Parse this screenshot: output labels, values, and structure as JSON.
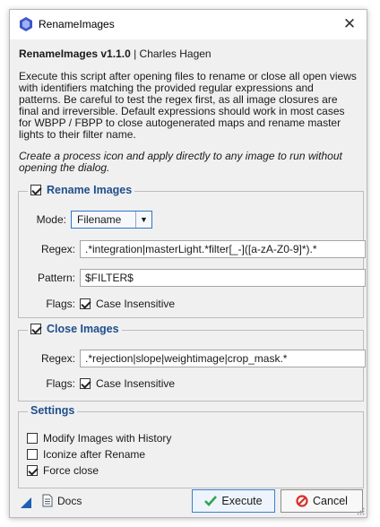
{
  "window": {
    "title": "RenameImages",
    "close_symbol": "✕"
  },
  "header": {
    "name": "RenameImages v1.1.0",
    "separator": " | ",
    "author": "Charles Hagen"
  },
  "description": "Execute this script after opening files to rename or close all open views with identifiers matching the provided regular expressions and patterns. Be careful to test the regex first, as all image closures are final and irreversible. Default expressions should work in most cases for WBPP / FBPP to close autogenerated maps and rename master lights to their filter name.",
  "instruction": "Create a process icon and apply directly to any image to run without opening the dialog.",
  "rename_group": {
    "title": "Rename Images",
    "enabled": true,
    "mode_label": "Mode:",
    "mode_value": "Filename",
    "regex_label": "Regex:",
    "regex_value": ".*integration|masterLight.*filter[_-]([a-zA-Z0-9]*).*",
    "pattern_label": "Pattern:",
    "pattern_value": "$FILTER$",
    "flags_label": "Flags:",
    "case_label": "Case Insensitive",
    "case_checked": true
  },
  "close_group": {
    "title": "Close Images",
    "enabled": true,
    "regex_label": "Regex:",
    "regex_value": ".*rejection|slope|weightimage|crop_mask.*",
    "flags_label": "Flags:",
    "case_label": "Case Insensitive",
    "case_checked": true
  },
  "settings_group": {
    "title": "Settings",
    "options": [
      {
        "label": "Modify Images with History",
        "checked": false
      },
      {
        "label": "Iconize after Rename",
        "checked": false
      },
      {
        "label": "Force close",
        "checked": true
      }
    ]
  },
  "footer": {
    "docs_label": "Docs",
    "execute_label": "Execute",
    "cancel_label": "Cancel"
  },
  "colors": {
    "accent": "#1f4e8c",
    "execute_check": "#2fa44f",
    "cancel_icon": "#d9302c"
  },
  "icons": [
    "app-icon",
    "close-icon",
    "checkbox-icon",
    "dropdown-arrow-icon",
    "new-instance-icon",
    "document-icon",
    "checkmark-icon",
    "cancel-icon"
  ]
}
